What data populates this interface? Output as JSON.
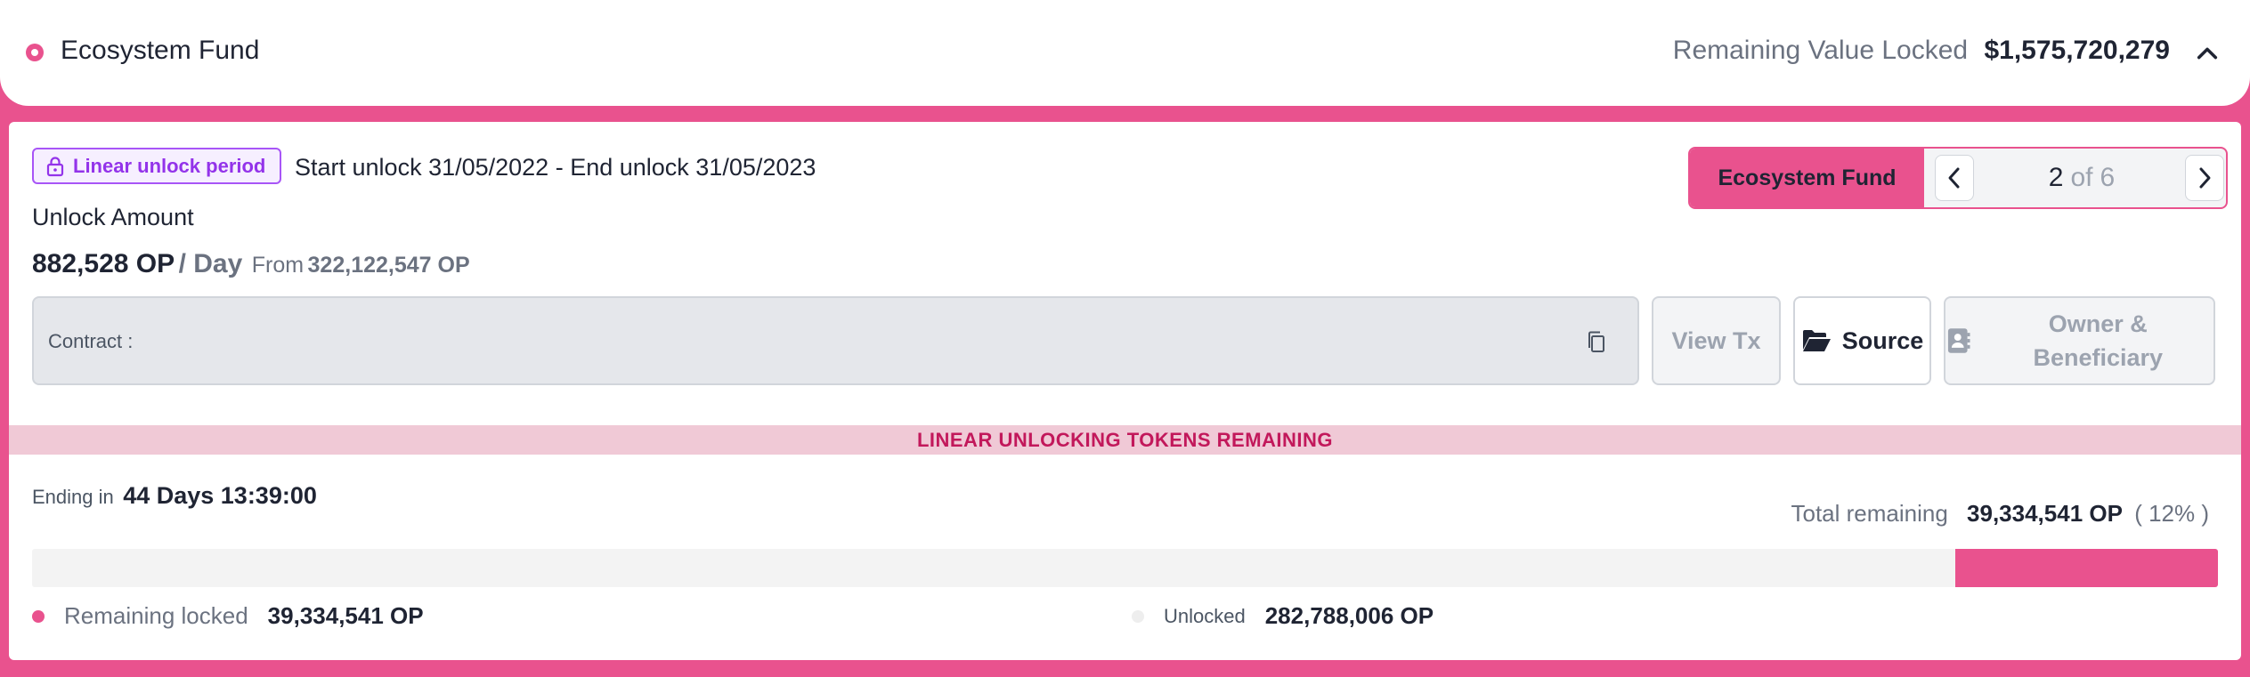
{
  "header": {
    "title": "Ecosystem Fund",
    "remaining_label": "Remaining Value Locked",
    "remaining_value": "$1,575,720,279",
    "toggle_icon": "chevron-up-icon"
  },
  "unlock": {
    "badge_label": "Linear unlock period",
    "badge_icon": "lock-icon",
    "period_text": "Start unlock 31/05/2022 - End unlock 31/05/2023",
    "amount_label": "Unlock Amount",
    "amount": "882,528 OP",
    "per": "/ Day",
    "from_label": "From",
    "from_value": "322,122,547 OP"
  },
  "switcher": {
    "name": "Ecosystem Fund",
    "current": "2",
    "of_label": "of",
    "total": "6"
  },
  "contract": {
    "label": "Contract :",
    "copy_icon": "copy-icon"
  },
  "actions": {
    "view_tx": "View Tx",
    "source": "Source",
    "source_icon": "folder-open-icon",
    "owner": "Owner & Beneficiary",
    "owner_icon": "contact-book-icon"
  },
  "section": {
    "title": "LINEAR UNLOCKING TOKENS REMAINING"
  },
  "status": {
    "ending_label": "Ending in",
    "ending_value": "44 Days 13:39:00",
    "total_label": "Total remaining",
    "total_value": "39,334,541 OP",
    "total_pct": "( 12% )"
  },
  "progress": {
    "remaining_fraction": 0.12
  },
  "legend": {
    "locked_label": "Remaining locked",
    "locked_value": "39,334,541 OP",
    "unlocked_label": "Unlocked",
    "unlocked_value": "282,788,006 OP"
  },
  "colors": {
    "accent": "#e9528e",
    "badge": "#a855f7",
    "section_text": "#c2185b"
  }
}
